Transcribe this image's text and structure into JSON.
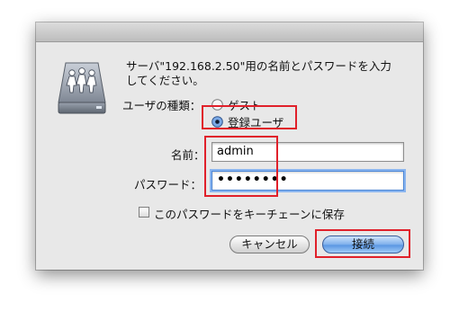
{
  "dialog": {
    "icon": "shared-server-icon",
    "message": "サーバ\"192.168.2.50\"用の名前とパスワードを入力\nしてください。",
    "user_type_label": "ユーザの種類：",
    "user_types": [
      {
        "label": "ゲスト",
        "selected": false
      },
      {
        "label": "登録ユーザ",
        "selected": true
      }
    ],
    "name_label": "名前：",
    "name_value": "admin",
    "password_label": "パスワード：",
    "password_masked": "••••••••",
    "save_password_label": "このパスワードをキーチェーンに保存",
    "save_password_checked": false,
    "cancel_label": "キャンセル",
    "connect_label": "接続"
  },
  "colors": {
    "highlight": "#e0202a",
    "dialog_bg": "#e8e8e8",
    "primary_button": "#5a96e3",
    "focus_ring": "#8ab5ef"
  }
}
